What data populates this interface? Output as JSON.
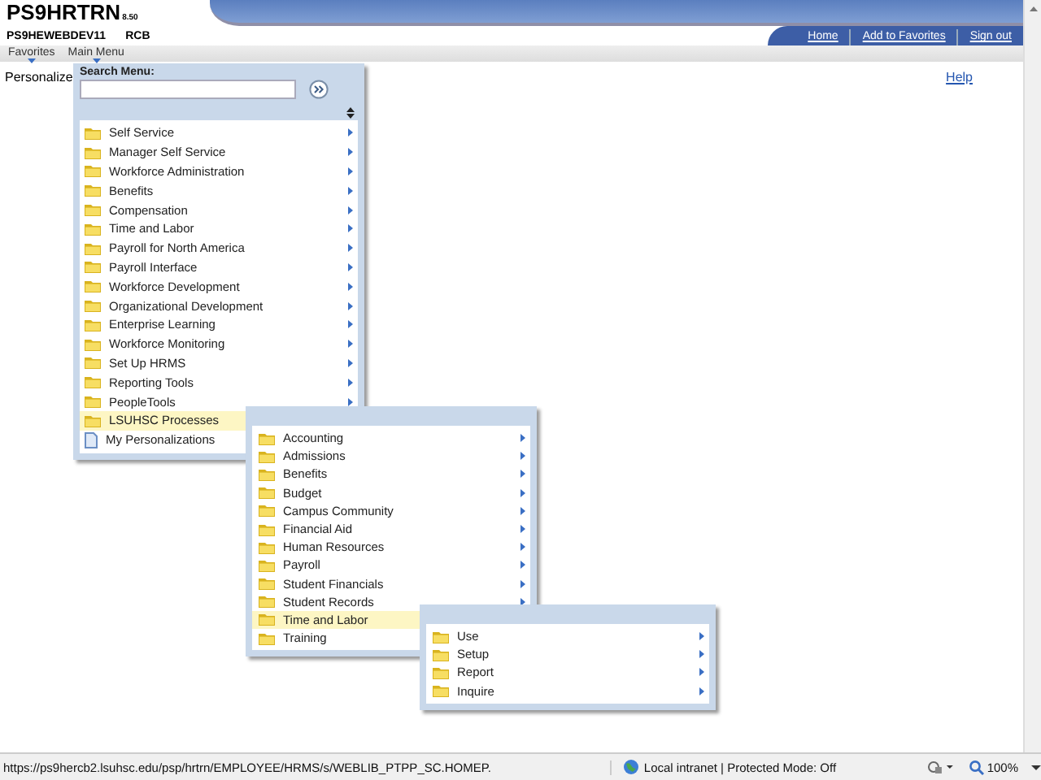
{
  "header": {
    "app_name": "PS9HRTRN",
    "version": "8.50",
    "database": "PS9HEWEBDEV11",
    "user": "RCB",
    "links": [
      "Home",
      "Add to Favorites",
      "Sign out"
    ]
  },
  "nav": {
    "items": [
      "Favorites",
      "Main Menu"
    ]
  },
  "page": {
    "personalize": "Personalize",
    "help": "Help"
  },
  "menus": [
    {
      "search": {
        "label": "Search Menu:"
      },
      "items": [
        {
          "label": "Self Service",
          "kind": "folder",
          "submenu": true,
          "selected": false
        },
        {
          "label": "Manager Self Service",
          "kind": "folder",
          "submenu": true,
          "selected": false
        },
        {
          "label": "Workforce Administration",
          "kind": "folder",
          "submenu": true,
          "selected": false
        },
        {
          "label": "Benefits",
          "kind": "folder",
          "submenu": true,
          "selected": false
        },
        {
          "label": "Compensation",
          "kind": "folder",
          "submenu": true,
          "selected": false
        },
        {
          "label": "Time and Labor",
          "kind": "folder",
          "submenu": true,
          "selected": false
        },
        {
          "label": "Payroll for North America",
          "kind": "folder",
          "submenu": true,
          "selected": false
        },
        {
          "label": "Payroll Interface",
          "kind": "folder",
          "submenu": true,
          "selected": false
        },
        {
          "label": "Workforce Development",
          "kind": "folder",
          "submenu": true,
          "selected": false
        },
        {
          "label": "Organizational Development",
          "kind": "folder",
          "submenu": true,
          "selected": false
        },
        {
          "label": "Enterprise Learning",
          "kind": "folder",
          "submenu": true,
          "selected": false
        },
        {
          "label": "Workforce Monitoring",
          "kind": "folder",
          "submenu": true,
          "selected": false
        },
        {
          "label": "Set Up HRMS",
          "kind": "folder",
          "submenu": true,
          "selected": false
        },
        {
          "label": "Reporting Tools",
          "kind": "folder",
          "submenu": true,
          "selected": false
        },
        {
          "label": "PeopleTools",
          "kind": "folder",
          "submenu": true,
          "selected": false
        },
        {
          "label": "LSUHSC Processes",
          "kind": "folder",
          "selected": true
        },
        {
          "label": "My Personalizations",
          "kind": "page",
          "selected": false
        }
      ]
    },
    {
      "items": [
        {
          "label": "Accounting",
          "kind": "folder",
          "submenu": true,
          "selected": false
        },
        {
          "label": "Admissions",
          "kind": "folder",
          "submenu": true,
          "selected": false
        },
        {
          "label": "Benefits",
          "kind": "folder",
          "submenu": true,
          "selected": false
        },
        {
          "label": "Budget",
          "kind": "folder",
          "submenu": true,
          "selected": false
        },
        {
          "label": "Campus Community",
          "kind": "folder",
          "submenu": true,
          "selected": false
        },
        {
          "label": "Financial Aid",
          "kind": "folder",
          "submenu": true,
          "selected": false
        },
        {
          "label": "Human Resources",
          "kind": "folder",
          "submenu": true,
          "selected": false
        },
        {
          "label": "Payroll",
          "kind": "folder",
          "submenu": true,
          "selected": false
        },
        {
          "label": "Student Financials",
          "kind": "folder",
          "submenu": true,
          "selected": false
        },
        {
          "label": "Student Records",
          "kind": "folder",
          "submenu": true,
          "selected": false
        },
        {
          "label": "Time and Labor",
          "kind": "folder",
          "selected": true
        },
        {
          "label": "Training",
          "kind": "folder",
          "selected": false
        }
      ]
    },
    {
      "items": [
        {
          "label": "Use",
          "kind": "folder",
          "submenu": true,
          "selected": false
        },
        {
          "label": "Setup",
          "kind": "folder",
          "submenu": true,
          "selected": false
        },
        {
          "label": "Report",
          "kind": "folder",
          "submenu": true,
          "selected": false
        },
        {
          "label": "Inquire",
          "kind": "folder",
          "submenu": true,
          "selected": false
        }
      ]
    }
  ],
  "status_bar": {
    "url": "https://ps9hercb2.lsuhsc.edu/psp/hrtrn/EMPLOYEE/HRMS/s/WEBLIB_PTPP_SC.HOMEP.",
    "zone": "Local intranet | Protected Mode: Off",
    "zoom": "100%"
  }
}
